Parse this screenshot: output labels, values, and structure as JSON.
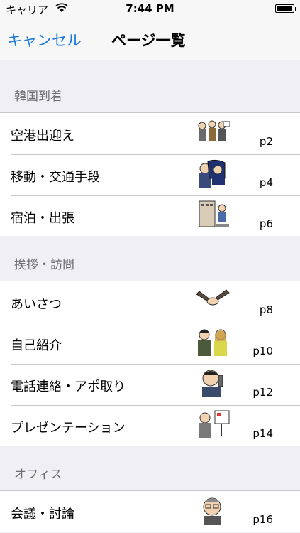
{
  "status": {
    "carrier": "キャリア",
    "time": "7:44 PM",
    "battery_level": 0.95
  },
  "nav": {
    "cancel_label": "キャンセル",
    "title": "ページ一覧"
  },
  "colors": {
    "accent": "#1a7ad9",
    "section_text": "#6d6d72",
    "background": "#efeff4"
  },
  "sections": [
    {
      "header": "韓国到着",
      "rows": [
        {
          "label": "空港出迎え",
          "page": "p2",
          "thumbnail": "airport-greeting-illustration"
        },
        {
          "label": "移動・交通手段",
          "page": "p4",
          "thumbnail": "transportation-illustration"
        },
        {
          "label": "宿泊・出張",
          "page": "p6",
          "thumbnail": "hotel-illustration"
        }
      ]
    },
    {
      "header": "挨拶・訪問",
      "rows": [
        {
          "label": "あいさつ",
          "page": "p8",
          "thumbnail": "handshake-illustration"
        },
        {
          "label": "自己紹介",
          "page": "p10",
          "thumbnail": "self-introduction-illustration"
        },
        {
          "label": "電話連絡・アポ取り",
          "page": "p12",
          "thumbnail": "phone-call-illustration"
        },
        {
          "label": "プレゼンテーション",
          "page": "p14",
          "thumbnail": "presentation-illustration"
        }
      ]
    },
    {
      "header": "オフィス",
      "rows": [
        {
          "label": "会議・討論",
          "page": "p16",
          "thumbnail": "meeting-illustration"
        }
      ]
    }
  ]
}
